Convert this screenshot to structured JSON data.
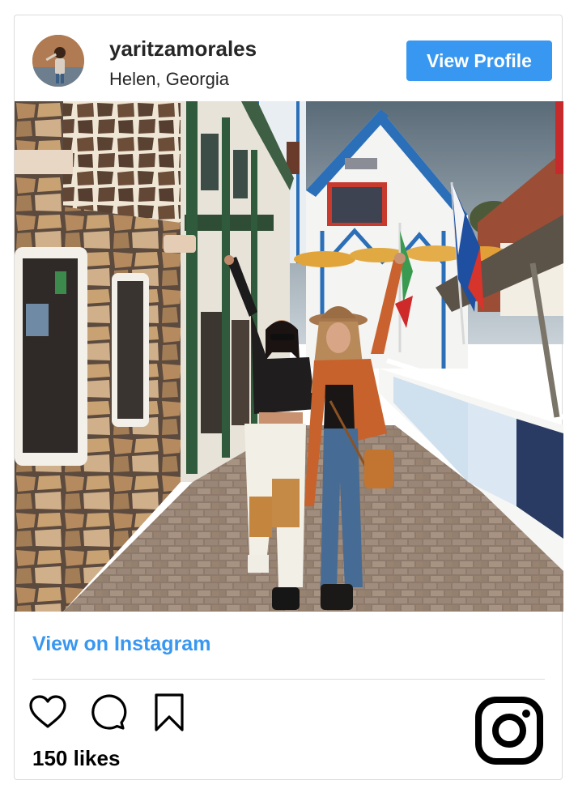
{
  "post": {
    "username": "yaritzamorales",
    "location": "Helen, Georgia",
    "view_profile_label": "View Profile",
    "view_on_instagram_label": "View on Instagram",
    "likes_text": "150 likes"
  },
  "icons": {
    "like": "heart-icon",
    "comment": "comment-icon",
    "save": "bookmark-icon",
    "brand": "instagram-logo-icon"
  },
  "colors": {
    "accent": "#3897f0",
    "text": "#262626",
    "border": "#dbdbdb"
  }
}
